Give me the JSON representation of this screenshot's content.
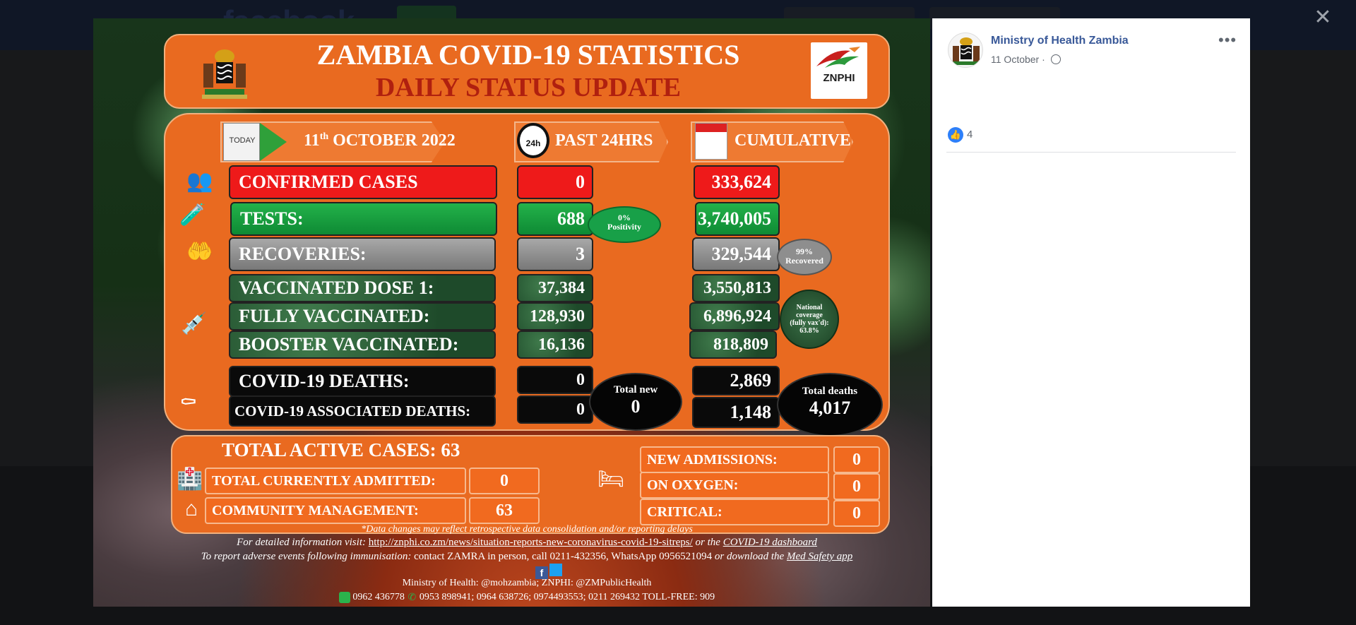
{
  "background_site": {
    "logo": "facebook"
  },
  "viewer": {
    "close_icon": "close-icon"
  },
  "infographic": {
    "title": "ZAMBIA COVID-19 STATISTICS",
    "subtitle": "DAILY STATUS UPDATE",
    "znphi_logo_text": "ZNPHI",
    "today_label": "TODAY",
    "date": "11th OCTOBER 2022",
    "date_day": "11",
    "date_suffix": "th",
    "date_rest": " OCTOBER 2022",
    "col_past": "PAST 24HRS",
    "clock_label": "24h",
    "col_cumulative": "CUMULATIVE",
    "rows": {
      "confirmed": {
        "label": "CONFIRMED CASES",
        "past": "0",
        "cum": "333,624"
      },
      "tests": {
        "label": "TESTS:",
        "past": "688",
        "cum": "3,740,005",
        "positivity": "0%",
        "positivity_label": "Positivity"
      },
      "recoveries": {
        "label": "RECOVERIES:",
        "past": "3",
        "cum": "329,544",
        "recovered_pct": "99%",
        "recovered_label": "Recovered"
      },
      "dose1": {
        "label": "VACCINATED DOSE 1:",
        "past": "37,384",
        "cum": "3,550,813"
      },
      "fully": {
        "label": "FULLY VACCINATED:",
        "past": "128,930",
        "cum": "6,896,924"
      },
      "booster": {
        "label": "BOOSTER VACCINATED:",
        "past": "16,136",
        "cum": "818,809"
      },
      "coverage_line1": "National",
      "coverage_line2": "coverage",
      "coverage_line3": "(fully vax'd):",
      "coverage_value": "63.8%",
      "deaths": {
        "label": "COVID-19 DEATHS:",
        "past": "0",
        "cum": "2,869"
      },
      "assoc_deaths": {
        "label": "COVID-19 ASSOCIATED DEATHS:",
        "past": "0",
        "cum": "1,148"
      },
      "total_new_label": "Total new",
      "total_new_value": "0",
      "total_deaths_label": "Total deaths",
      "total_deaths_value": "4,017"
    },
    "lower": {
      "active_cases": "TOTAL ACTIVE CASES: 63",
      "admitted_label": "TOTAL CURRENTLY ADMITTED:",
      "admitted_value": "0",
      "community_label": "COMMUNITY MANAGEMENT:",
      "community_value": "63",
      "new_adm_label": "NEW ADMISSIONS:",
      "new_adm_value": "0",
      "oxygen_label": "ON OXYGEN:",
      "oxygen_value": "0",
      "critical_label": "CRITICAL:",
      "critical_value": "0"
    },
    "footer": {
      "note": "*Data changes may reflect retrospective data consolidation and/or reporting delays",
      "info_prefix": "For detailed information visit: ",
      "info_link": "http://znphi.co.zm/news/situation-reports-new-coronavirus-covid-19-sitreps/",
      "info_mid": " or the ",
      "info_dash": "COVID-19 dashboard",
      "adverse_prefix": "To report adverse events following immunisation: ",
      "adverse_contact": "contact ZAMRA in person, call 0211-432356, WhatsApp 0956521094",
      "adverse_mid": " or download the ",
      "adverse_app": "Med Safety app",
      "social": "Ministry of Health: @mohzambia; ZNPHI: @ZMPublicHealth",
      "phone1": "0962 436778",
      "phone2": "0953 898941; 0964 638726; 0974493553; 0211 269432 TOLL-FREE: 909"
    }
  },
  "post": {
    "page_name": "Ministry of Health Zambia",
    "date": "11 October",
    "separator": "·",
    "more_label": "•••",
    "like_count": "4"
  }
}
